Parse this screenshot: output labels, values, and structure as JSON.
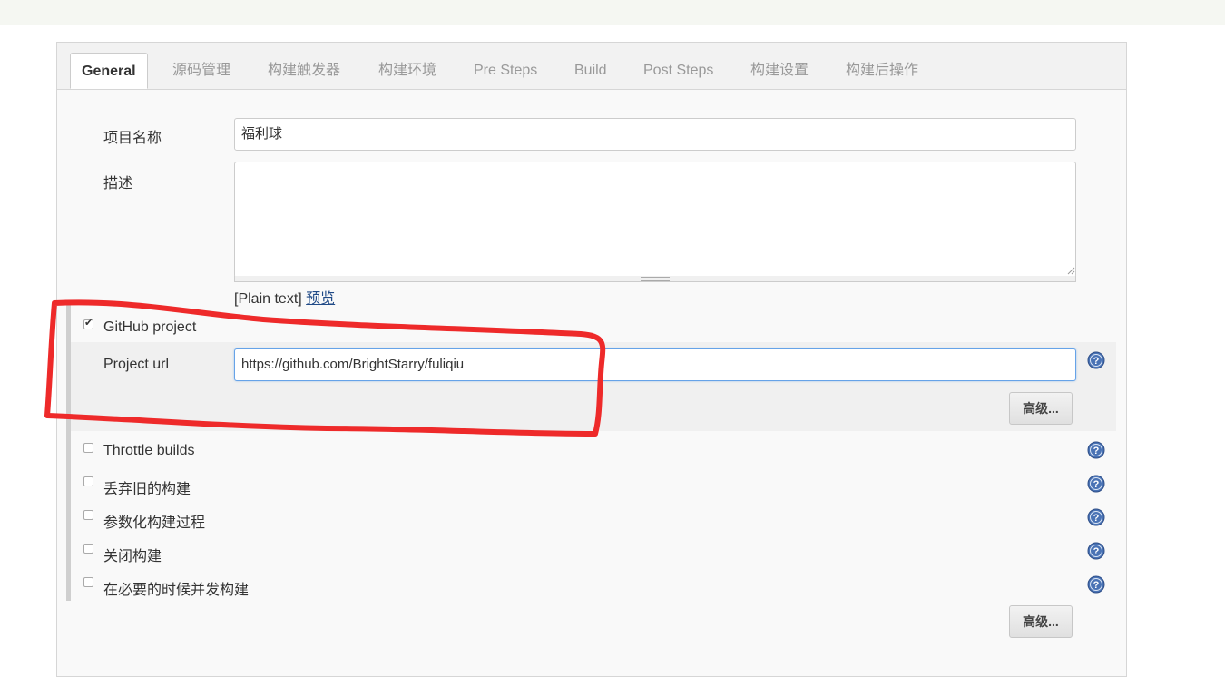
{
  "tabs": [
    {
      "label": "General",
      "active": true
    },
    {
      "label": "源码管理"
    },
    {
      "label": "构建触发器"
    },
    {
      "label": "构建环境"
    },
    {
      "label": "Pre Steps"
    },
    {
      "label": "Build"
    },
    {
      "label": "Post Steps"
    },
    {
      "label": "构建设置"
    },
    {
      "label": "构建后操作"
    }
  ],
  "form": {
    "project_name_label": "项目名称",
    "project_name_value": "福利球",
    "description_label": "描述",
    "description_value": "",
    "plain_text": "[Plain text]",
    "preview_link": "预览",
    "github_project_label": "GitHub project",
    "github_project_checked": true,
    "project_url_label": "Project url",
    "project_url_value": "https://github.com/BrightStarry/fuliqiu",
    "advanced_button": "高级...",
    "options": [
      {
        "label": "Throttle builds",
        "checked": false
      },
      {
        "label": "丢弃旧的构建",
        "checked": false
      },
      {
        "label": "参数化构建过程",
        "checked": false
      },
      {
        "label": "关闭构建",
        "checked": false
      },
      {
        "label": "在必要的时候并发构建",
        "checked": false
      }
    ],
    "advanced_button_bottom": "高级..."
  },
  "icons": {
    "help": "help-icon",
    "checkbox": "checkbox"
  },
  "colors": {
    "annotation": "#ee2a2a",
    "focus_border": "#66a3e8",
    "help_icon": "#4a73b5"
  }
}
